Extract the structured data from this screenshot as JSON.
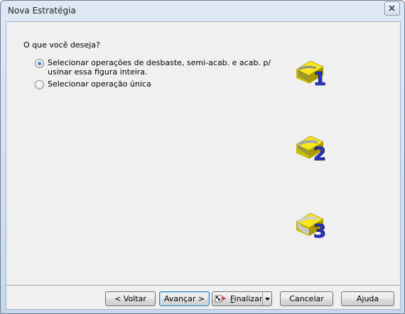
{
  "window": {
    "title": "Nova Estratégia"
  },
  "question": "O que você deseja?",
  "options": [
    {
      "label_line1": "Selecionar operações de desbaste, semi-acab. e acab. p/",
      "label_line2": "usinar essa figura inteira.",
      "checked": true
    },
    {
      "label_line1": "Selecionar operação única",
      "checked": false
    }
  ],
  "icons": [
    {
      "name": "roughing-strategy-icon",
      "number": "1"
    },
    {
      "name": "semi-finishing-strategy-icon",
      "number": "2"
    },
    {
      "name": "finishing-strategy-icon",
      "number": "3"
    }
  ],
  "buttons": {
    "back": "< Voltar",
    "next": "Avançar >",
    "finish_underlined": "F",
    "finish_rest": "inalizar",
    "cancel": "Cancelar",
    "help": "Ajuda"
  },
  "colors": {
    "icon_yellow": "#f7e81d",
    "icon_number_blue": "#2a36c8",
    "default_button_border": "#3c7fb1"
  }
}
